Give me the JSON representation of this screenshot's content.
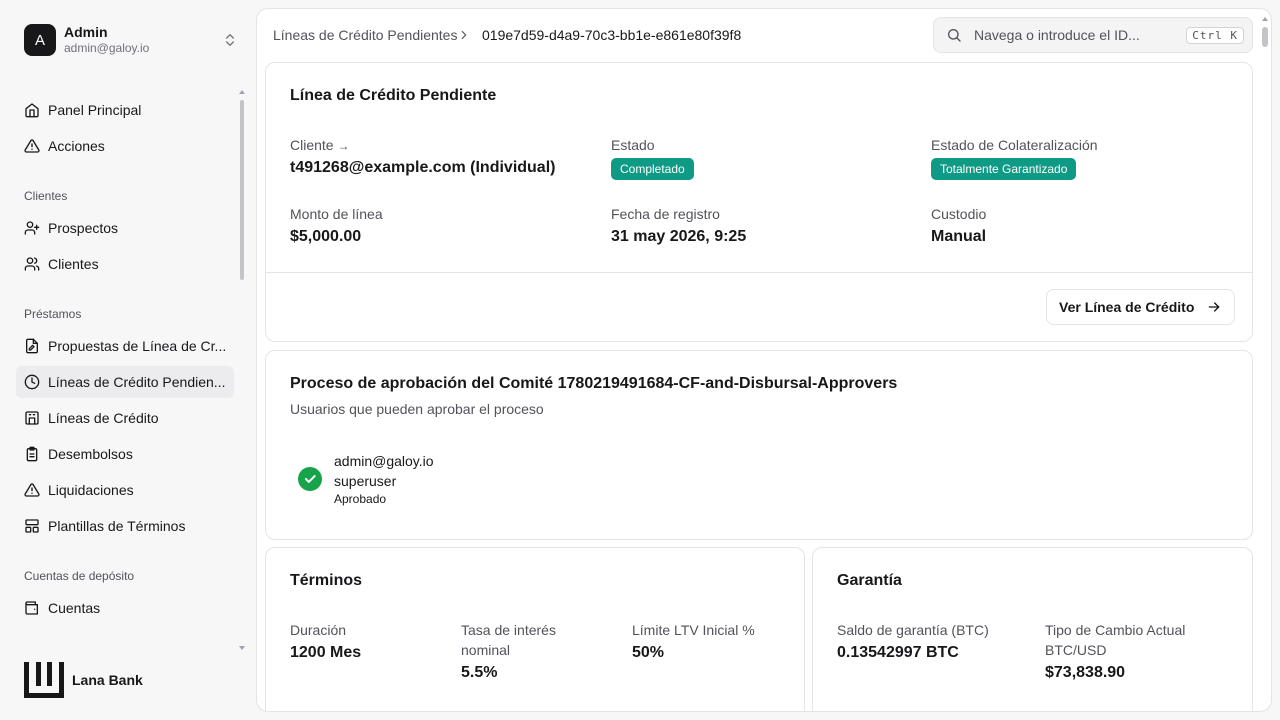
{
  "user": {
    "initial": "A",
    "name": "Admin",
    "email": "admin@galoy.io"
  },
  "sidebar": {
    "top_items": [
      {
        "label": "Panel Principal",
        "icon": "home-icon"
      },
      {
        "label": "Acciones",
        "icon": "alert-triangle-icon"
      }
    ],
    "sections": [
      {
        "label": "Clientes",
        "items": [
          {
            "label": "Prospectos",
            "icon": "user-plus-icon"
          },
          {
            "label": "Clientes",
            "icon": "users-icon"
          }
        ]
      },
      {
        "label": "Préstamos",
        "items": [
          {
            "label": "Propuestas de Línea de Cr...",
            "icon": "file-edit-icon"
          },
          {
            "label": "Líneas de Crédito Pendien...",
            "icon": "clock-icon",
            "active": true
          },
          {
            "label": "Líneas de Crédito",
            "icon": "building-icon"
          },
          {
            "label": "Desembolsos",
            "icon": "clipboard-icon"
          },
          {
            "label": "Liquidaciones",
            "icon": "alert-triangle-icon"
          },
          {
            "label": "Plantillas de Términos",
            "icon": "layout-icon"
          }
        ]
      },
      {
        "label": "Cuentas de depósito",
        "items": [
          {
            "label": "Cuentas",
            "icon": "wallet-icon"
          }
        ]
      }
    ],
    "brand": "Lana Bank"
  },
  "header": {
    "breadcrumb_parent": "Líneas de Crédito Pendientes",
    "breadcrumb_current": "019e7d59-d4a9-70c3-bb1e-e861e80f39f8",
    "search_placeholder": "Navega o introduce el ID...",
    "search_shortcut": "Ctrl K"
  },
  "pending_card": {
    "title": "Línea de Crédito Pendiente",
    "client_label": "Cliente",
    "client_value": "t491268@example.com (Individual)",
    "status_label": "Estado",
    "status_value": "Completado",
    "collateral_state_label": "Estado de Colateralización",
    "collateral_state_value": "Totalmente Garantizado",
    "amount_label": "Monto de línea",
    "amount_value": "$5,000.00",
    "date_label": "Fecha de registro",
    "date_value": "31 may 2026, 9:25",
    "custody_label": "Custodio",
    "custody_value": "Manual",
    "view_button": "Ver Línea de Crédito"
  },
  "approval_card": {
    "title": "Proceso de aprobación del Comité 1780219491684-CF-and-Disbursal-Approvers",
    "subtitle": "Usuarios que pueden aprobar el proceso",
    "approver_email": "admin@galoy.io",
    "approver_role": "superuser",
    "approver_status": "Aprobado"
  },
  "terms_card": {
    "title": "Términos",
    "duration_label": "Duración",
    "duration_value": "1200 Mes",
    "rate_label_1": "Tasa de interés",
    "rate_label_2": "nominal",
    "rate_value": "5.5%",
    "ltv_label": "Límite LTV Inicial %",
    "ltv_value": "50%"
  },
  "collateral_card": {
    "title": "Garantía",
    "balance_label": "Saldo de garantía (BTC)",
    "balance_value": "0.13542997 BTC",
    "rate_label_1": "Tipo de Cambio Actual",
    "rate_label_2": "BTC/USD",
    "rate_value": "$73,838.90"
  },
  "colors": {
    "badge": "#0f9a86",
    "approved": "#16a34a",
    "active_bg": "#ececee"
  }
}
